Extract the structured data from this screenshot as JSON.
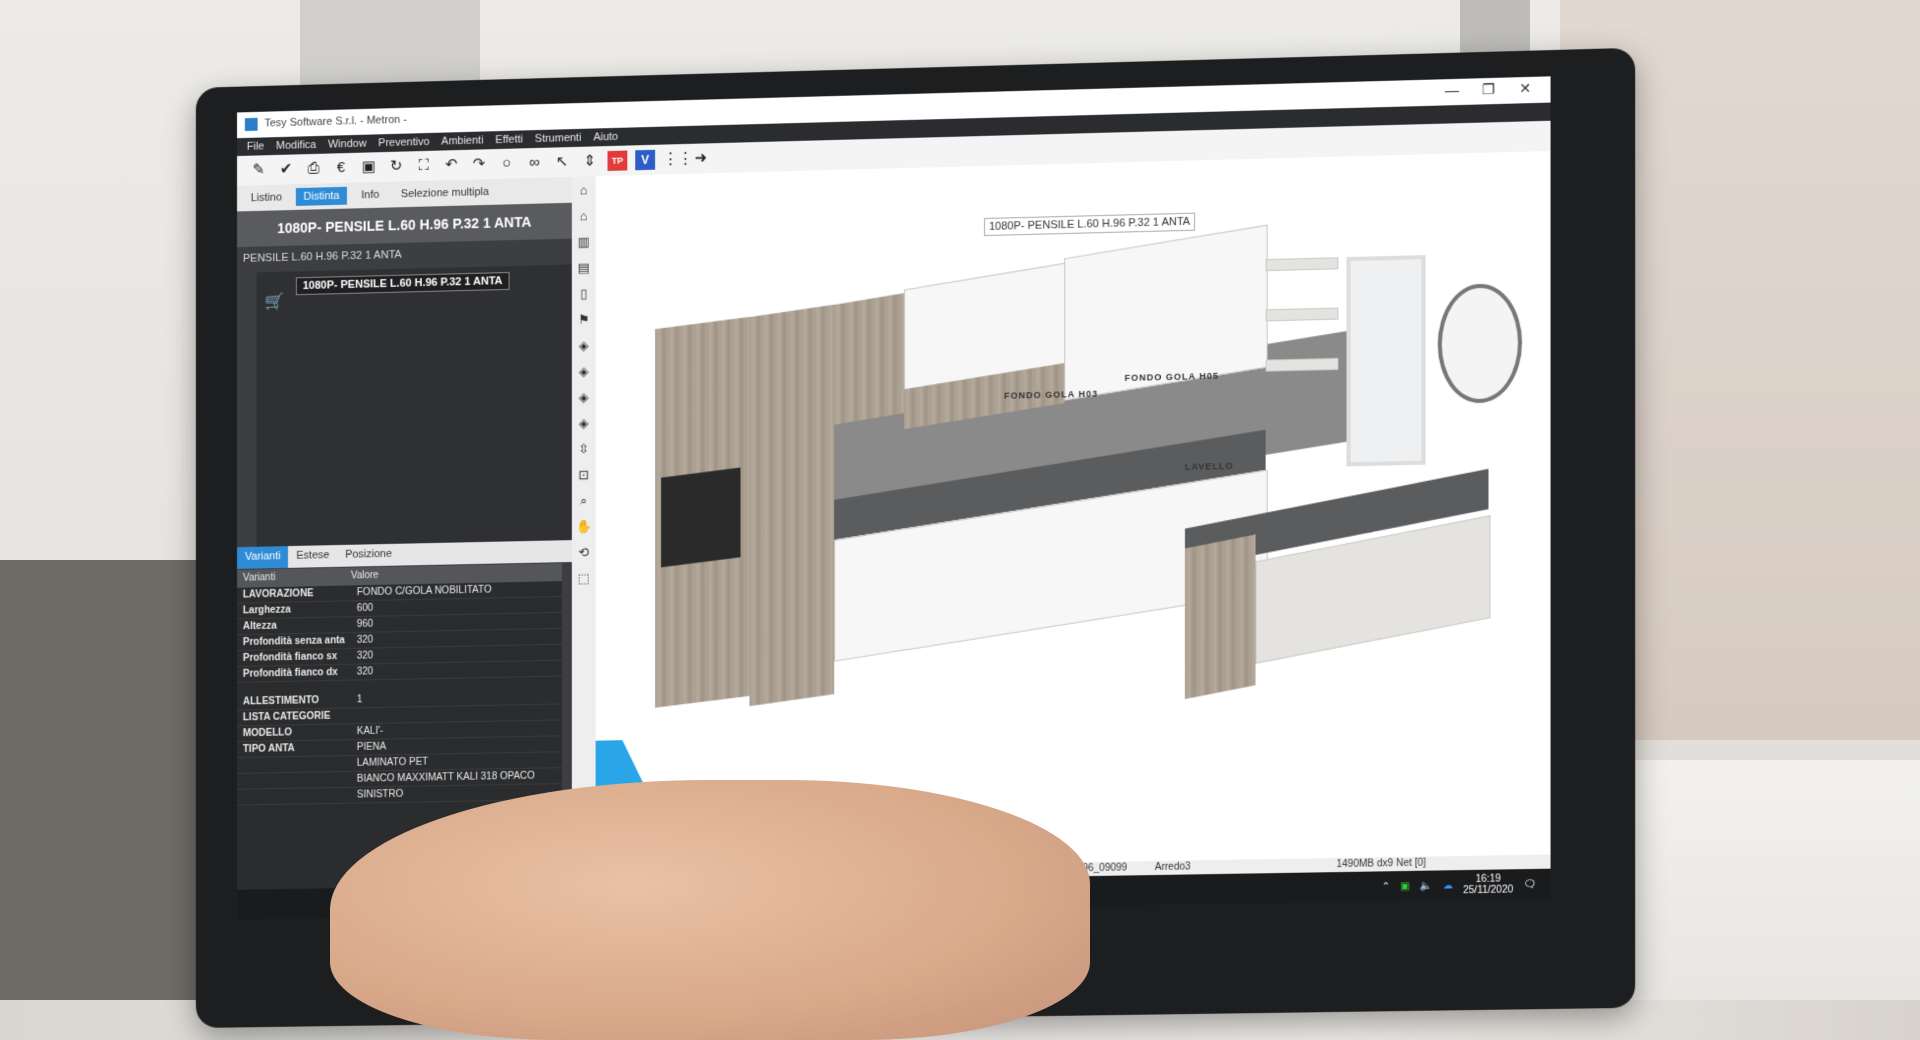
{
  "window": {
    "title": "Tesy Software S.r.l. - Metron -",
    "controls": {
      "minimize": "—",
      "maximize": "❐",
      "close": "✕"
    }
  },
  "menu": [
    "File",
    "Modifica",
    "Window",
    "Preventivo",
    "Ambienti",
    "Effetti",
    "Strumenti",
    "Aiuto"
  ],
  "toolbar": {
    "icons": [
      "pencil-icon",
      "check-icon",
      "print-icon",
      "euro-icon",
      "frame-icon",
      "refresh-icon",
      "fullscreen-icon",
      "undo-icon",
      "redo-icon",
      "bulb-icon",
      "glasses-icon",
      "cursor-icon",
      "measure-icon",
      "tp-icon",
      "v-icon",
      "grid-icon",
      "arrow-right-icon"
    ],
    "tp_label": "TP",
    "v_label": "V"
  },
  "left_panel": {
    "tabs": [
      "Listino",
      "Distinta",
      "Info",
      "Selezione multipla"
    ],
    "active_tab": "Distinta",
    "header": "1080P- PENSILE L.60 H.96 P.32 1 ANTA",
    "subtitle": "PENSILE L.60 H.96 P.32 1 ANTA",
    "tree_item": "1080P- PENSILE L.60 H.96 P.32 1 ANTA",
    "variant_tabs": [
      "Varianti",
      "Estese",
      "Posizione"
    ],
    "table_headers": [
      "Varianti",
      "Valore"
    ],
    "rows_group1": [
      {
        "k": "LAVORAZIONE",
        "v": "FONDO C/GOLA NOBILITATO"
      },
      {
        "k": "Larghezza",
        "v": "600"
      },
      {
        "k": "Altezza",
        "v": "960"
      },
      {
        "k": "Profondità senza anta",
        "v": "320"
      },
      {
        "k": "Profondità fianco sx",
        "v": "320"
      },
      {
        "k": "Profondità fianco dx",
        "v": "320"
      }
    ],
    "rows_group2": [
      {
        "k": "ALLESTIMENTO",
        "v": "1"
      },
      {
        "k": "LISTA CATEGORIE",
        "v": ""
      },
      {
        "k": "MODELLO",
        "v": "KALI'-"
      },
      {
        "k": "TIPO ANTA",
        "v": "PIENA"
      },
      {
        "k": "",
        "v": "LAMINATO PET"
      },
      {
        "k": "",
        "v": "BIANCO MAXXIMATT KALI 318 OPACO"
      },
      {
        "k": "",
        "v": "SINISTRO"
      }
    ]
  },
  "viewport": {
    "tooltip": "1080P- PENSILE L.60 H.96 P.32 1 ANTA",
    "label_fondo_gola_1": "FONDO GOLA H03",
    "label_fondo_gola_2": "FONDO GOLA H05",
    "label_lavello": "LAVELLO"
  },
  "status": {
    "project": "20_LIC11264_96_09099  2020_LIC11264_96_09099",
    "ambient": "Arredo3",
    "memory": "1490MB dx9  Net [0]"
  },
  "taskbar": {
    "time": "16:19",
    "date": "25/11/2020"
  }
}
